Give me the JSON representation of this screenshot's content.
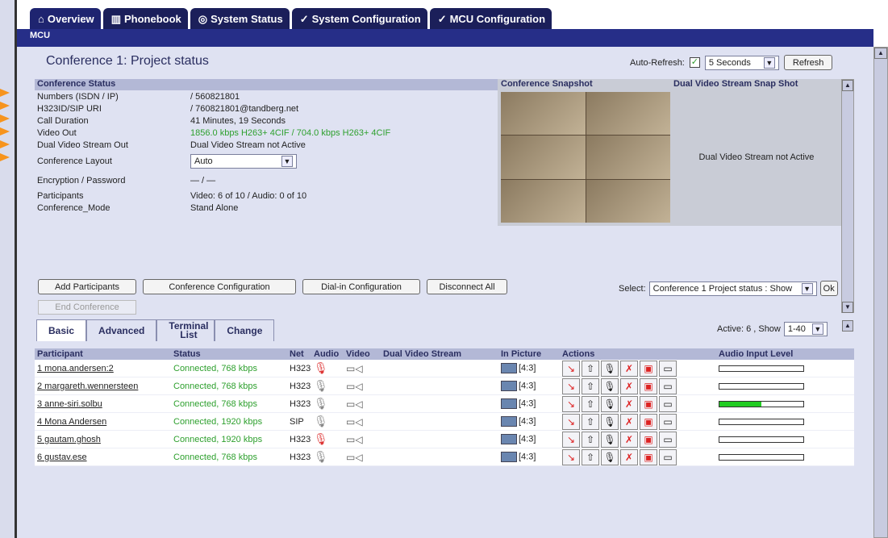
{
  "tabs": [
    {
      "label": "Overview",
      "icon": "house-icon"
    },
    {
      "label": "Phonebook",
      "icon": "book-icon"
    },
    {
      "label": "System Status",
      "icon": "status-icon"
    },
    {
      "label": "System Configuration",
      "icon": "wrench-icon"
    },
    {
      "label": "MCU Configuration",
      "icon": "wrench-icon"
    }
  ],
  "section_label": "MCU",
  "page_title": "Conference 1: Project status",
  "auto_refresh": {
    "label": "Auto-Refresh:",
    "checked": true,
    "interval": "5 Seconds",
    "refresh_button": "Refresh"
  },
  "conference_status": {
    "heading": "Conference Status",
    "rows": [
      {
        "label": "Numbers (ISDN / IP)",
        "value": "/ 560821801"
      },
      {
        "label": "H323ID/SIP URI",
        "value": "/ 760821801@tandberg.net"
      },
      {
        "label": "Call Duration",
        "value": "41 Minutes, 19 Seconds"
      },
      {
        "label": "Video Out",
        "value": "1856.0 kbps H263+ 4CIF / 704.0 kbps H263+ 4CIF"
      },
      {
        "label": "Dual Video Stream Out",
        "value": "Dual Video Stream not Active"
      },
      {
        "label": "Conference Layout",
        "value": "Auto"
      },
      {
        "label": "Encryption / Password",
        "value": "— / —"
      },
      {
        "label": "Participants",
        "value": "Video: 6 of 10  / Audio: 0 of 10"
      },
      {
        "label": "Conference_Mode",
        "value": "Stand Alone"
      }
    ]
  },
  "snapshot": {
    "heading": "Conference Snapshot",
    "dual_heading": "Dual Video Stream Snap Shot",
    "dual_text": "Dual Video Stream not Active"
  },
  "buttons": {
    "add": "Add Participants",
    "config": "Conference Configuration",
    "dialin": "Dial-in Configuration",
    "disconnect": "Disconnect All",
    "end": "End Conference"
  },
  "select": {
    "label": "Select:",
    "value": "Conference 1 Project status : Show",
    "ok": "Ok"
  },
  "ptabs": [
    "Basic",
    "Advanced",
    "Terminal List",
    "Change"
  ],
  "active_show": {
    "label": "Active: 6 , Show",
    "value": "1-40"
  },
  "headers": [
    "Participant",
    "Status",
    "Net",
    "Audio",
    "Video",
    "Dual Video Stream",
    "In Picture",
    "Actions",
    "Audio Input Level"
  ],
  "participants": [
    {
      "name": "1 mona.andersen:2",
      "status": "Connected, 768 kbps",
      "net": "H323",
      "muted": true,
      "pic": "[4:3]",
      "level": 0
    },
    {
      "name": "2 margareth.wennersteen",
      "status": "Connected, 768 kbps",
      "net": "H323",
      "muted": false,
      "pic": "[4:3]",
      "level": 0
    },
    {
      "name": "3 anne-siri.solbu",
      "status": "Connected, 768 kbps",
      "net": "H323",
      "muted": false,
      "pic": "[4:3]",
      "level": 0.5
    },
    {
      "name": "4 Mona Andersen",
      "status": "Connected, 1920 kbps",
      "net": "SIP",
      "muted": false,
      "pic": "[4:3]",
      "level": 0
    },
    {
      "name": "5 gautam.ghosh",
      "status": "Connected, 1920 kbps",
      "net": "H323",
      "muted": true,
      "pic": "[4:3]",
      "level": 0
    },
    {
      "name": "6 gustav.ese",
      "status": "Connected, 768 kbps",
      "net": "H323",
      "muted": false,
      "pic": "[4:3]",
      "level": 0
    }
  ],
  "colors": {
    "accent": "#262e88",
    "status_ok": "#2ea02e",
    "level_fill": "#22cc22",
    "arrow": "#f7941d"
  }
}
